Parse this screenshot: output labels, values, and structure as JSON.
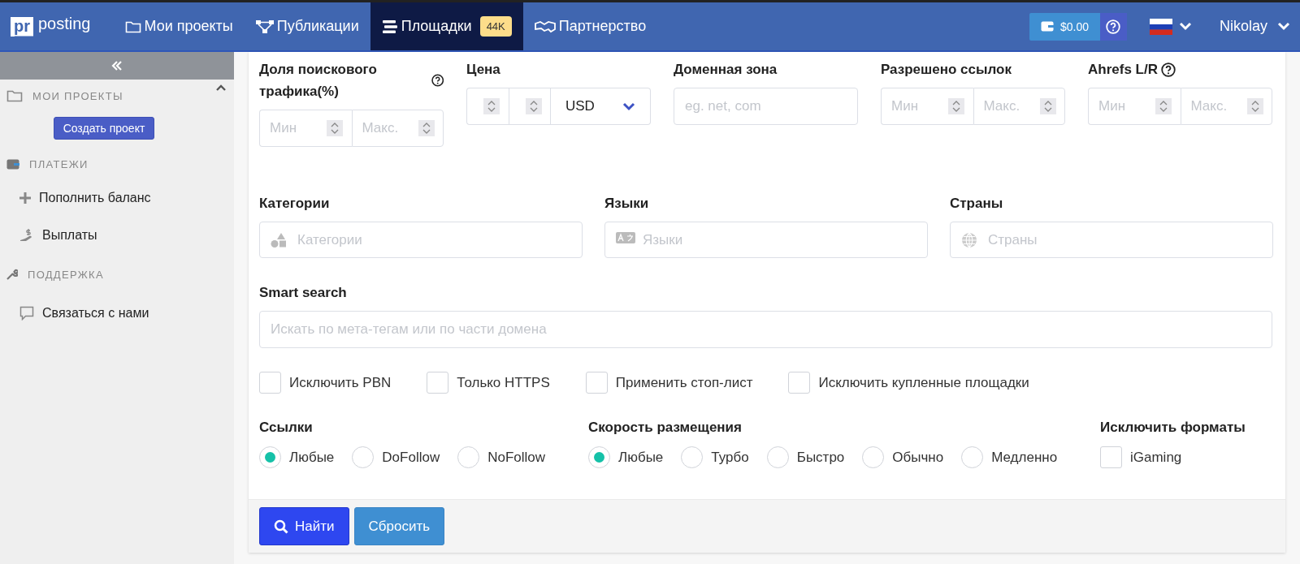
{
  "navbar": {
    "logo": {
      "mark": "pr",
      "text": "posting"
    },
    "items": [
      {
        "label": "Мои проекты",
        "selected": false
      },
      {
        "label": "Публикации",
        "selected": false
      },
      {
        "label": "Площадки",
        "selected": true,
        "badge": "44K"
      },
      {
        "label": "Партнерство",
        "selected": false
      }
    ],
    "balance": "$0.00",
    "user": "Nikolay"
  },
  "sidebar": {
    "sections": [
      {
        "title": "МОИ ПРОЕКТЫ",
        "expanded": true,
        "items": [
          {
            "kind": "button",
            "label": "Создать проект"
          }
        ]
      },
      {
        "title": "ПЛАТЕЖИ",
        "items": [
          {
            "kind": "link",
            "label": "Пополнить баланс"
          },
          {
            "kind": "link",
            "label": "Выплаты"
          }
        ]
      },
      {
        "title": "ПОДДЕРЖКА",
        "items": [
          {
            "kind": "link",
            "label": "Связаться с нами"
          }
        ]
      }
    ]
  },
  "filters": {
    "row_1": [
      {
        "kind": "range",
        "label": "Доля поискового трафика(%)",
        "help": true,
        "min_placeholder": "Мин",
        "max_placeholder": "Макс."
      },
      {
        "kind": "price",
        "label": "Цена",
        "currency": "USD"
      },
      {
        "kind": "text",
        "label": "Доменная зона",
        "placeholder": "eg. net, com"
      },
      {
        "kind": "range",
        "label": "Разрешено ссылок",
        "min_placeholder": "Мин",
        "max_placeholder": "Макс."
      },
      {
        "kind": "range",
        "label": "Ahrefs L/R",
        "help": true,
        "min_placeholder": "Мин",
        "max_placeholder": "Макс."
      }
    ],
    "row_2": [
      {
        "label": "Категории",
        "placeholder": "Категории"
      },
      {
        "label": "Языки",
        "placeholder": "Языки"
      },
      {
        "label": "Страны",
        "placeholder": "Страны"
      }
    ],
    "smart_search": {
      "label": "Smart search",
      "placeholder": "Искать по мета-тегам или по части домена"
    },
    "checkboxes": [
      {
        "label": "Исключить PBN",
        "checked": false
      },
      {
        "label": "Только HTTPS",
        "checked": false
      },
      {
        "label": "Применить стоп-лист",
        "checked": false
      },
      {
        "label": "Исключить купленные площадки",
        "checked": false
      }
    ],
    "groups": [
      {
        "kind": "radio",
        "label": "Ссылки",
        "options": [
          {
            "label": "Любые",
            "selected": true
          },
          {
            "label": "DoFollow",
            "selected": false
          },
          {
            "label": "NoFollow",
            "selected": false
          }
        ]
      },
      {
        "kind": "radio",
        "label": "Скорость размещения",
        "options": [
          {
            "label": "Любые",
            "selected": true
          },
          {
            "label": "Турбо",
            "selected": false
          },
          {
            "label": "Быстро",
            "selected": false
          },
          {
            "label": "Обычно",
            "selected": false
          },
          {
            "label": "Медленно",
            "selected": false
          }
        ]
      },
      {
        "kind": "checkbox",
        "label": "Исключить форматы",
        "options": [
          {
            "label": "iGaming",
            "checked": false
          }
        ]
      }
    ],
    "buttons": [
      {
        "kind": "primary",
        "label": "Найти"
      },
      {
        "kind": "secondary",
        "label": "Сбросить"
      }
    ]
  }
}
